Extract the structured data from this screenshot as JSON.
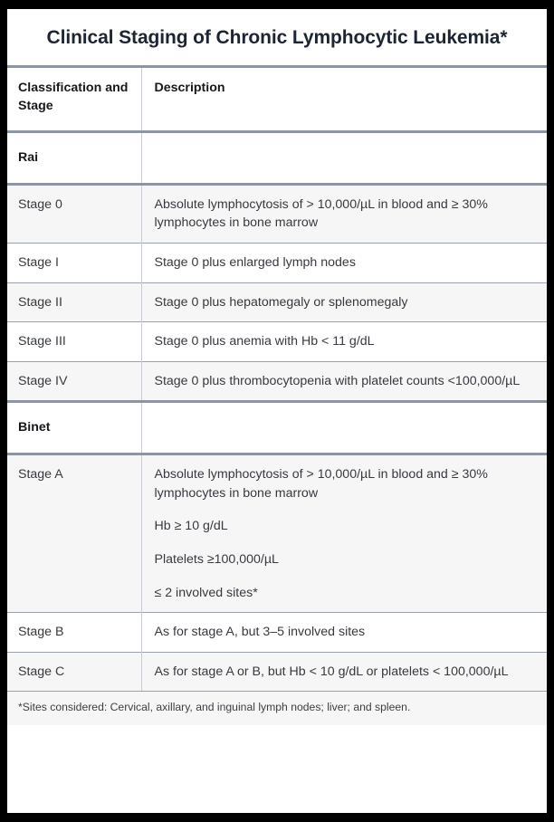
{
  "title": "Clinical Staging of Chronic Lymphocytic Leukemia*",
  "table": {
    "columns": {
      "stage": "Classification and Stage",
      "description": "Description"
    },
    "sections": [
      {
        "name": "Rai",
        "rows": [
          {
            "stage": "Stage 0",
            "paragraphs": [
              "Absolute lymphocytosis of > 10,000/µL in blood and ≥ 30% lymphocytes in bone marrow"
            ]
          },
          {
            "stage": "Stage I",
            "paragraphs": [
              "Stage 0 plus enlarged lymph nodes"
            ]
          },
          {
            "stage": "Stage II",
            "paragraphs": [
              "Stage 0 plus hepatomegaly or splenomegaly"
            ]
          },
          {
            "stage": "Stage III",
            "paragraphs": [
              "Stage 0 plus anemia with Hb < 11 g/dL"
            ]
          },
          {
            "stage": "Stage IV",
            "paragraphs": [
              "Stage 0 plus thrombocytopenia with platelet counts <100,000/µL"
            ]
          }
        ]
      },
      {
        "name": "Binet",
        "rows": [
          {
            "stage": "Stage A",
            "paragraphs": [
              "Absolute lymphocytosis of > 10,000/µL in blood and ≥ 30% lymphocytes in bone marrow",
              "Hb ≥ 10 g/dL",
              "Platelets ≥100,000/µL",
              "≤ 2 involved sites*"
            ]
          },
          {
            "stage": "Stage B",
            "paragraphs": [
              "As for stage A, but 3–5 involved sites"
            ]
          },
          {
            "stage": "Stage C",
            "paragraphs": [
              "As for stage A or B, but Hb < 10 g/dL or platelets < 100,000/µL"
            ]
          }
        ]
      }
    ]
  },
  "footnote": "*Sites considered: Cervical, axillary, and inguinal lymph nodes; liver; and spleen."
}
